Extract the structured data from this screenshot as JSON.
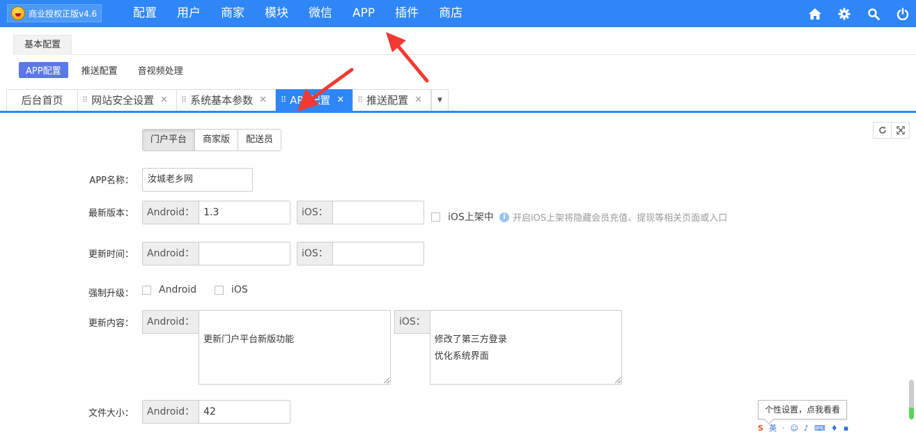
{
  "app": {
    "title": "商业授权正版v4.6"
  },
  "topnav": [
    "配置",
    "用户",
    "商家",
    "模块",
    "微信",
    "APP",
    "插件",
    "商店"
  ],
  "top_icons": [
    "home-icon",
    "gear-icon",
    "search-icon",
    "power-icon"
  ],
  "module_tab": "基本配置",
  "subnav": [
    "APP配置",
    "推送配置",
    "音视频处理"
  ],
  "page_tabs": [
    "后台首页",
    "网站安全设置",
    "系统基本参数",
    "APP配置",
    "推送配置"
  ],
  "platform_buttons": [
    "门户平台",
    "商家版",
    "配送员"
  ],
  "form": {
    "app_name_label": "APP名称：",
    "app_name_value": "汝城老乡网",
    "version_label": "最新版本：",
    "android_addon": "Android：",
    "ios_addon": "iOS：",
    "version_android": "1.3",
    "version_ios": "",
    "ios_listed_label": "iOS上架中",
    "ios_listed_hint": "开启iOS上架将隐藏会员充值、提现等相关页面或入口",
    "update_time_label": "更新时间：",
    "update_time_android": "",
    "update_time_ios": "",
    "force_label": "强制升级：",
    "force_android": "Android",
    "force_ios": "iOS",
    "content_label": "更新内容：",
    "content_android": "更新门户平台新版功能",
    "content_ios": "修改了第三方登录\n优化系统界面",
    "size_label": "文件大小：",
    "size_android": "42"
  },
  "tooltip": "个性设置，点我看看",
  "ime_bar": [
    "S",
    "英",
    "·",
    "☺",
    "♪",
    "⌨",
    "♦",
    "▪"
  ],
  "colors": {
    "primary": "#2f86f6",
    "active_sub": "#5a78e7",
    "arrow": "#f03a33"
  }
}
